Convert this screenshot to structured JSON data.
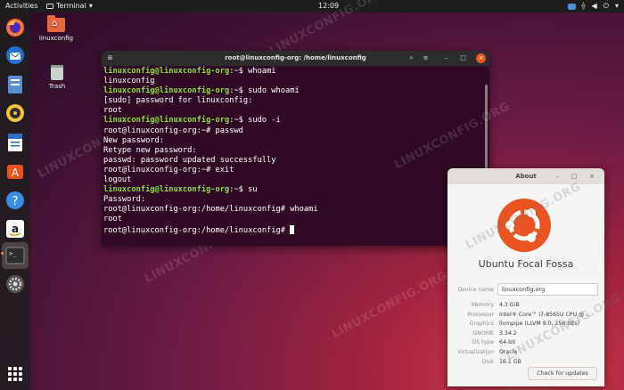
{
  "topbar": {
    "activities": "Activities",
    "app_name": "Terminal",
    "app_arrow": "▾",
    "clock": "12:09",
    "tray_icons": [
      "network-icon",
      "volume-icon",
      "power-icon",
      "menu-arrow-icon"
    ]
  },
  "desktop": {
    "home_label": "linuxconfig",
    "trash_label": "Trash"
  },
  "dock": {
    "items": [
      "firefox-icon",
      "thunderbird-icon",
      "files-icon",
      "rhythmbox-icon",
      "writer-icon",
      "software-icon",
      "help-icon",
      "amazon-icon",
      "terminal-icon",
      "settings-icon"
    ],
    "show_apps": "show-applications-icon"
  },
  "terminal": {
    "title": "root@linuxconfig-org: /home/linuxconfig",
    "lines": [
      {
        "user": "linuxconfig@linuxconfig-org",
        "sep": ":~$",
        "cmd": " whoami"
      },
      {
        "text": "linuxconfig"
      },
      {
        "user": "linuxconfig@linuxconfig-org",
        "sep": ":~$",
        "cmd": " sudo whoami"
      },
      {
        "text": "[sudo] password for linuxconfig:"
      },
      {
        "text": "root"
      },
      {
        "user": "linuxconfig@linuxconfig-org",
        "sep": ":~$",
        "cmd": " sudo -i"
      },
      {
        "text": "root@linuxconfig-org:~# passwd"
      },
      {
        "text": "New password:"
      },
      {
        "text": "Retype new password:"
      },
      {
        "text": "passwd: password updated successfully"
      },
      {
        "text": "root@linuxconfig-org:~# exit"
      },
      {
        "text": "logout"
      },
      {
        "user": "linuxconfig@linuxconfig-org",
        "sep": ":~$",
        "cmd": " su"
      },
      {
        "text": "Password:"
      },
      {
        "text": "root@linuxconfig-org:/home/linuxconfig# whoami"
      },
      {
        "text": "root"
      },
      {
        "text": "root@linuxconfig-org:/home/linuxconfig# ",
        "cursor": true
      }
    ],
    "colors": {
      "background": "#300a24",
      "prompt": "#8ae234"
    }
  },
  "about": {
    "title": "About",
    "distro_name": "Ubuntu Focal Fossa",
    "device_name_label": "Device name",
    "device_name_value": "linuxconfig.org",
    "rows": [
      {
        "key": "Memory",
        "value": "4.3 GiB"
      },
      {
        "key": "Processor",
        "value": "Intel® Core™ i7-8565U CPU @ ..."
      },
      {
        "key": "Graphics",
        "value": "llvmpipe (LLVM 9.0, 256 bits)"
      },
      {
        "key": "GNOME",
        "value": "3.34.2"
      },
      {
        "key": "OS type",
        "value": "64-bit"
      },
      {
        "key": "Virtualization",
        "value": "Oracle"
      },
      {
        "key": "Disk",
        "value": "16.1 GB"
      }
    ],
    "check_updates": "Check for updates",
    "accent_color": "#e95420"
  },
  "watermark": "LINUXCONFIG.ORG"
}
